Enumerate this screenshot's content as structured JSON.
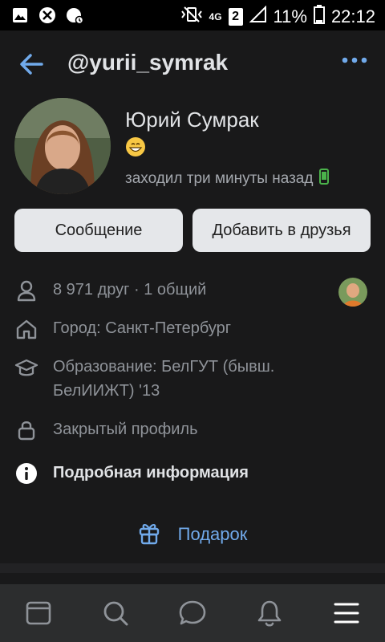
{
  "status_bar": {
    "network": "4G",
    "sim": "2",
    "battery": "11%",
    "time": "22:12"
  },
  "header": {
    "username": "@yurii_symrak"
  },
  "profile": {
    "name": "Юрий Сумрак",
    "status_emoji": "😁",
    "last_seen": "заходил три минуты назад"
  },
  "actions": {
    "message_label": "Сообщение",
    "add_friend_label": "Добавить в друзья"
  },
  "info": {
    "friends": "8 971 друг · 1 общий",
    "city": "Город: Санкт-Петербург",
    "education_line1": "Образование: БелГУТ (бывш.",
    "education_line2": "БелИИЖТ) '13",
    "privacy": "Закрытый профиль",
    "details": "Подробная информация"
  },
  "gift": {
    "label": "Подарок"
  },
  "tabbar": {
    "tabs": [
      "feed-icon",
      "search-icon",
      "messages-icon",
      "notifications-icon",
      "menu-icon"
    ]
  },
  "colors": {
    "background": "#19191a",
    "accent": "#71aaeb",
    "button_bg": "#e5e7ea",
    "online_green": "#4bb34b"
  }
}
